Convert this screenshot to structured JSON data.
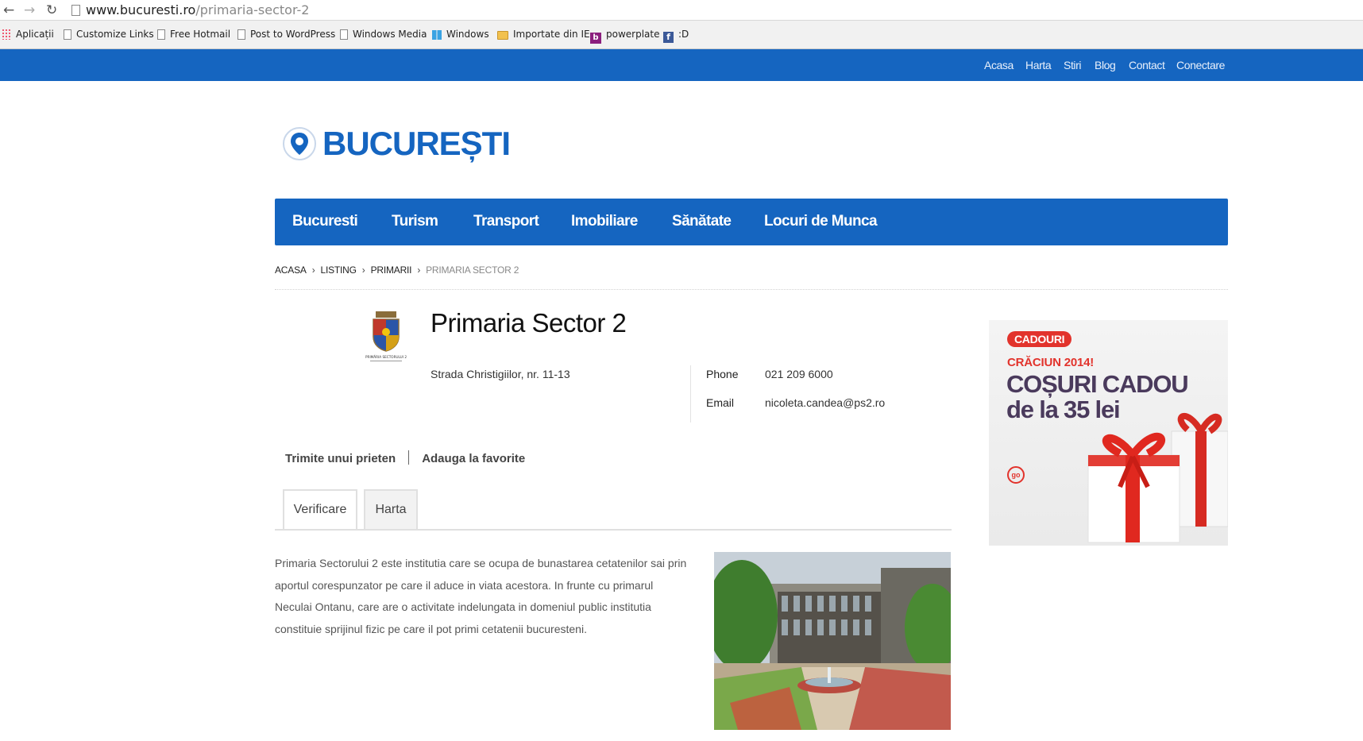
{
  "browser": {
    "url_host": "www.bucuresti.ro",
    "url_path": "/primaria-sector-2",
    "bookmarks": [
      {
        "label": "Aplicații",
        "icon": "apps-icon"
      },
      {
        "label": "Customize Links",
        "icon": "page-icon"
      },
      {
        "label": "Free Hotmail",
        "icon": "page-icon"
      },
      {
        "label": "Post to WordPress",
        "icon": "page-icon"
      },
      {
        "label": "Windows Media",
        "icon": "page-icon"
      },
      {
        "label": "Windows",
        "icon": "windows-icon"
      },
      {
        "label": "Importate din IE",
        "icon": "folder-icon"
      },
      {
        "label": "powerplate",
        "icon": "b-icon"
      },
      {
        "label": ":D",
        "icon": "facebook-icon"
      }
    ]
  },
  "topbar": {
    "links": [
      "Acasa",
      "Harta",
      "Stiri",
      "Blog",
      "Contact",
      "Conectare"
    ]
  },
  "logo": {
    "text": "BUCUREȘTI"
  },
  "mainnav": {
    "items": [
      "Bucuresti",
      "Turism",
      "Transport",
      "Imobiliare",
      "Sănătate",
      "Locuri de Munca"
    ]
  },
  "breadcrumb": {
    "items": [
      "ACASA",
      "LISTING",
      "PRIMARII"
    ],
    "current": "PRIMARIA SECTOR 2"
  },
  "listing": {
    "title": "Primaria Sector 2",
    "address": "Strada Christigiilor, nr. 11-13",
    "phone_label": "Phone",
    "phone": "021 209 6000",
    "email_label": "Email",
    "email": "nicoleta.candea@ps2.ro",
    "crest_caption": "PRIMĂRIA SECTORULUI 2"
  },
  "actions": {
    "send": "Trimite unui prieten",
    "favorite": "Adauga la favorite"
  },
  "tabs": [
    "Verificare",
    "Harta"
  ],
  "description": "Primaria Sectorului 2 este institutia care se ocupa de bunastarea cetatenilor sai prin aportul corespunzator pe care il aduce in viata acestora. In frunte cu primarul Neculai Ontanu, care are o activitate indelungata in domeniul public institutia constituie sprijinul fizic pe care il pot primi cetatenii bucuresteni.",
  "ad": {
    "badge": "CADOURI",
    "subtitle": "CRĂCIUN 2014!",
    "headline_1": "COȘURI CADOU",
    "headline_2": "de la 35 lei",
    "brand": "go"
  },
  "colors": {
    "brand_blue": "#1565c0",
    "ad_red": "#e2332c",
    "ad_purple": "#4a3a5c"
  }
}
